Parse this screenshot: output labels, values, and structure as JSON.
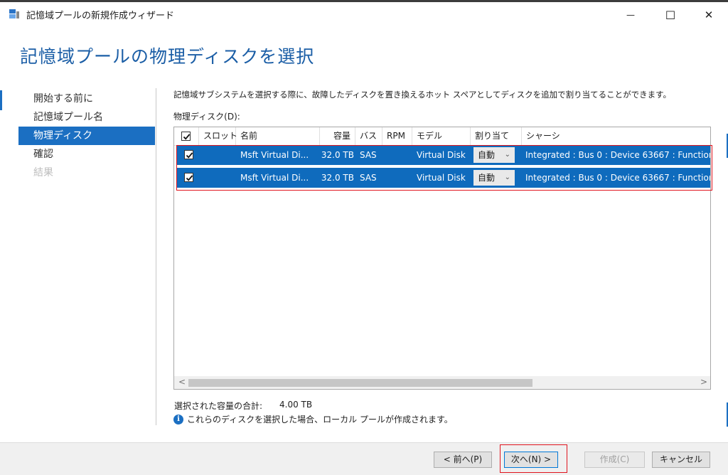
{
  "window": {
    "title": "記憶域プールの新規作成ウィザード",
    "minimize": "—",
    "maximize": "☐",
    "close": "✕"
  },
  "wizard": {
    "heading": "記憶域プールの物理ディスクを選択"
  },
  "nav": {
    "items": [
      {
        "label": "開始する前に"
      },
      {
        "label": "記憶域プール名"
      },
      {
        "label": "物理ディスク"
      },
      {
        "label": "確認"
      },
      {
        "label": "結果"
      }
    ]
  },
  "content": {
    "description": "記憶域サブシステムを選択する際に、故障したディスクを置き換えるホット スペアとしてディスクを追加で割り当てることができます。",
    "list_label": "物理ディスク(D):",
    "columns": [
      "スロット",
      "名前",
      "容量",
      "バス",
      "RPM",
      "モデル",
      "割り当て",
      "シャーシ"
    ],
    "rows": [
      {
        "checked": true,
        "slot": "",
        "name": "Msft Virtual Di...",
        "capacity": "32.0 TB",
        "bus": "SAS",
        "rpm": "",
        "model": "Virtual Disk",
        "allocation": "自動",
        "chassis": "Integrated : Bus 0 : Device 63667 : Function"
      },
      {
        "checked": true,
        "slot": "",
        "name": "Msft Virtual Di...",
        "capacity": "32.0 TB",
        "bus": "SAS",
        "rpm": "",
        "model": "Virtual Disk",
        "allocation": "自動",
        "chassis": "Integrated : Bus 0 : Device 63667 : Function"
      }
    ],
    "scroll_left": "<",
    "scroll_right": ">",
    "total_label": "選択された容量の合計:",
    "total_value": "4.00 TB",
    "info_icon": "i",
    "info_text": "これらのディスクを選択した場合、ローカル プールが作成されます。"
  },
  "footer": {
    "back": "< 前へ(P)",
    "next": "次へ(N) >",
    "create": "作成(C)",
    "cancel": "キャンセル"
  },
  "colors": {
    "accent": "#1b6fc2",
    "selected_row": "#0f6bbd",
    "heading": "#1b5ea6",
    "highlight_box": "#e0141e"
  }
}
